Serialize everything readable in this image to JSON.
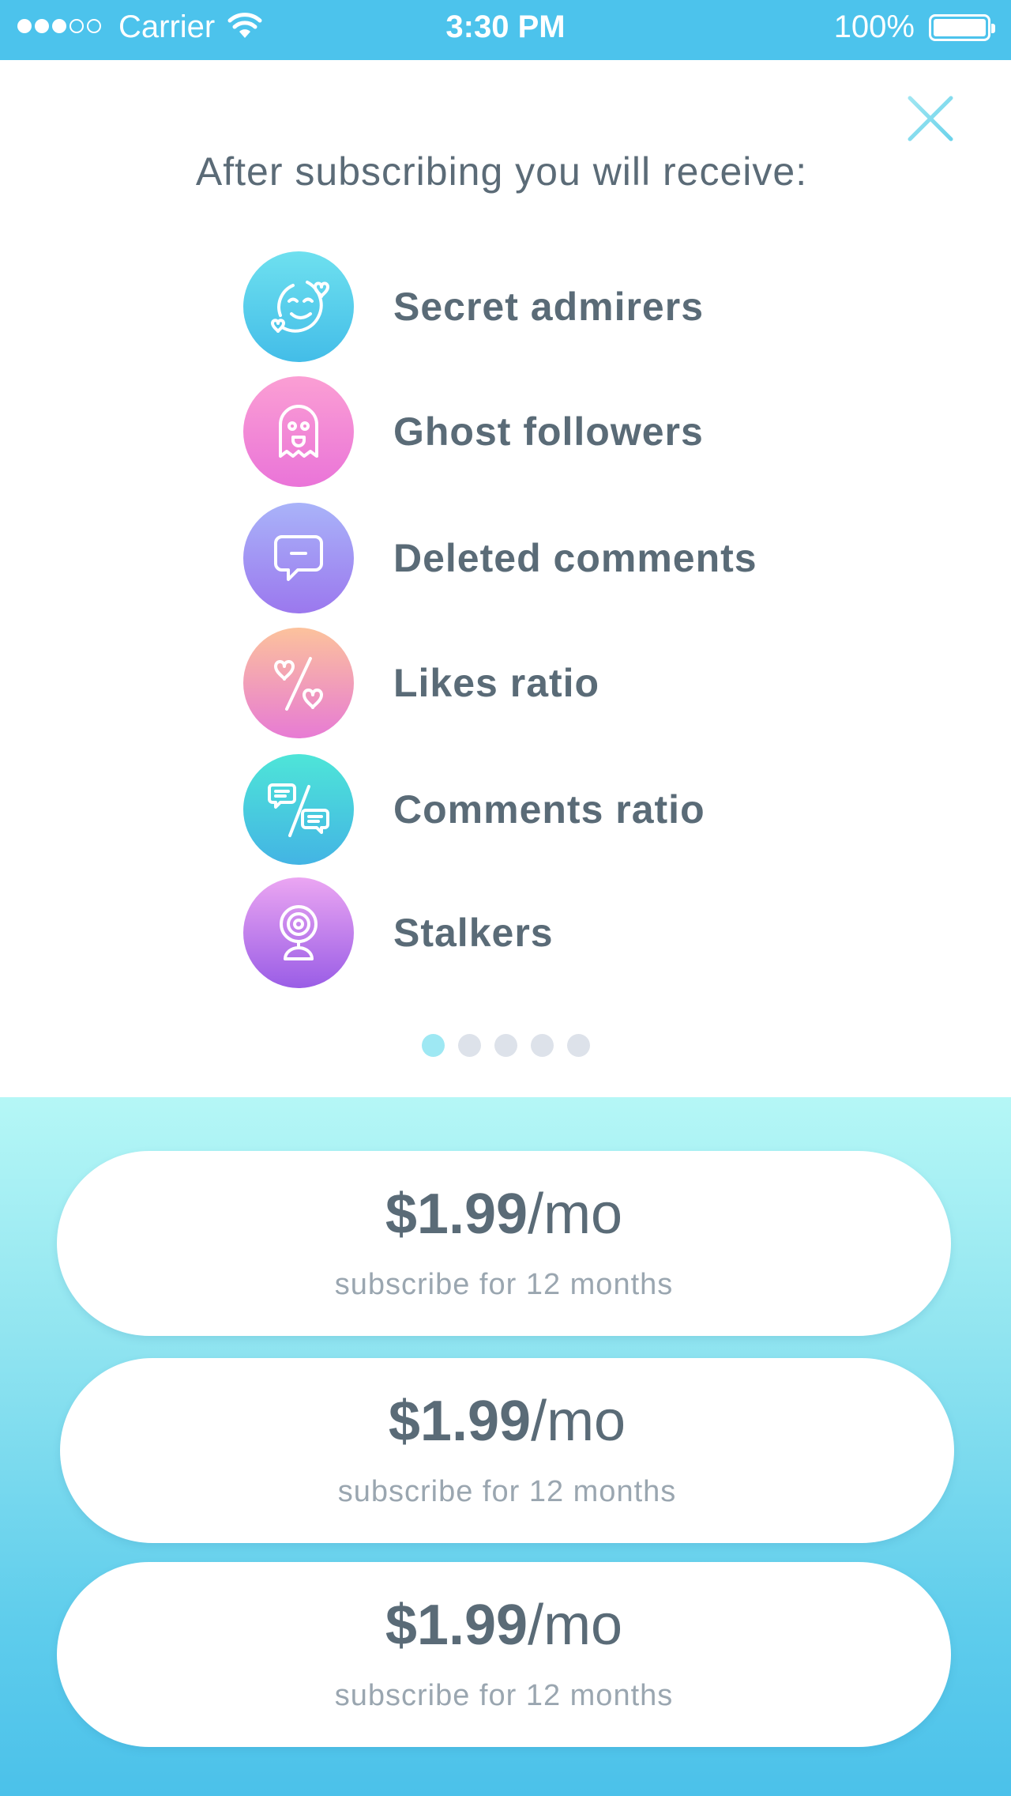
{
  "status_bar": {
    "carrier": "Carrier",
    "time": "3:30 PM",
    "battery": "100%",
    "signal_bars_filled": 3,
    "signal_bars_total": 5
  },
  "close": {
    "icon": "close-icon",
    "color": "#7fdcec"
  },
  "headline": "After subscribing you will receive:",
  "features": [
    {
      "label": "Secret admirers",
      "icon": "smiling-face-hearts-icon",
      "gradient": [
        "#6ee0ef",
        "#43bde8"
      ]
    },
    {
      "label": "Ghost followers",
      "icon": "ghost-icon",
      "gradient": [
        "#fb9fd4",
        "#ea74d8"
      ]
    },
    {
      "label": "Deleted comments",
      "icon": "comment-bubble-icon",
      "gradient": [
        "#a9b3f9",
        "#9b78ee"
      ]
    },
    {
      "label": "Likes ratio",
      "icon": "likes-ratio-icon",
      "gradient": [
        "#fcc29c",
        "#e77bd4"
      ]
    },
    {
      "label": "Comments ratio",
      "icon": "comments-ratio-icon",
      "gradient": [
        "#4ee5d8",
        "#43b4e4"
      ]
    },
    {
      "label": "Stalkers",
      "icon": "stalker-eye-icon",
      "gradient": [
        "#eba6f2",
        "#9a5de6"
      ]
    }
  ],
  "pager": {
    "count": 5,
    "active": 0
  },
  "plans": [
    {
      "price": "$1.99",
      "per": "/mo",
      "desc": "subscribe for 12 months"
    },
    {
      "price": "$1.99",
      "per": "/mo",
      "desc": "subscribe for 12 months"
    },
    {
      "price": "$1.99",
      "per": "/mo",
      "desc": "subscribe for 12 months"
    }
  ]
}
